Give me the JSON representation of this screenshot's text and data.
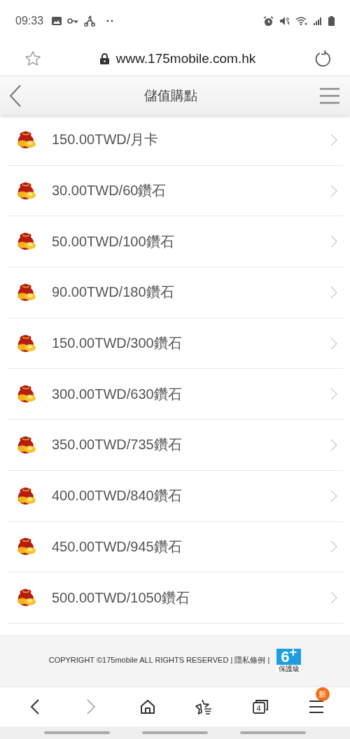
{
  "status_bar": {
    "time": "09:33"
  },
  "browser_bar": {
    "url": "www.175mobile.com.hk"
  },
  "header": {
    "title": "儲值購點"
  },
  "items": [
    {
      "label": "150.00TWD/月卡"
    },
    {
      "label": "30.00TWD/60鑽石"
    },
    {
      "label": "50.00TWD/100鑽石"
    },
    {
      "label": "90.00TWD/180鑽石"
    },
    {
      "label": "150.00TWD/300鑽石"
    },
    {
      "label": "300.00TWD/630鑽石"
    },
    {
      "label": "350.00TWD/735鑽石"
    },
    {
      "label": "400.00TWD/840鑽石"
    },
    {
      "label": "450.00TWD/945鑽石"
    },
    {
      "label": "500.00TWD/1050鑽石"
    }
  ],
  "footer": {
    "copyright": "COPYRIGHT ©175mobile ALL RIGHTS RESERVED |",
    "privacy_link": "隱私條例",
    "separator": "|",
    "rating": "6$^{+}$",
    "rating_label": "保護級"
  },
  "bottom_nav": [
    {
      "kind": "back",
      "disabled": false
    },
    {
      "kind": "forward",
      "disabled": true
    },
    {
      "kind": "home",
      "disabled": false
    },
    {
      "kind": "bookmarks",
      "disabled": false
    },
    {
      "kind": "tabs",
      "count": "4",
      "disabled": false
    },
    {
      "kind": "menu",
      "badge": "新",
      "disabled": false
    }
  ]
}
